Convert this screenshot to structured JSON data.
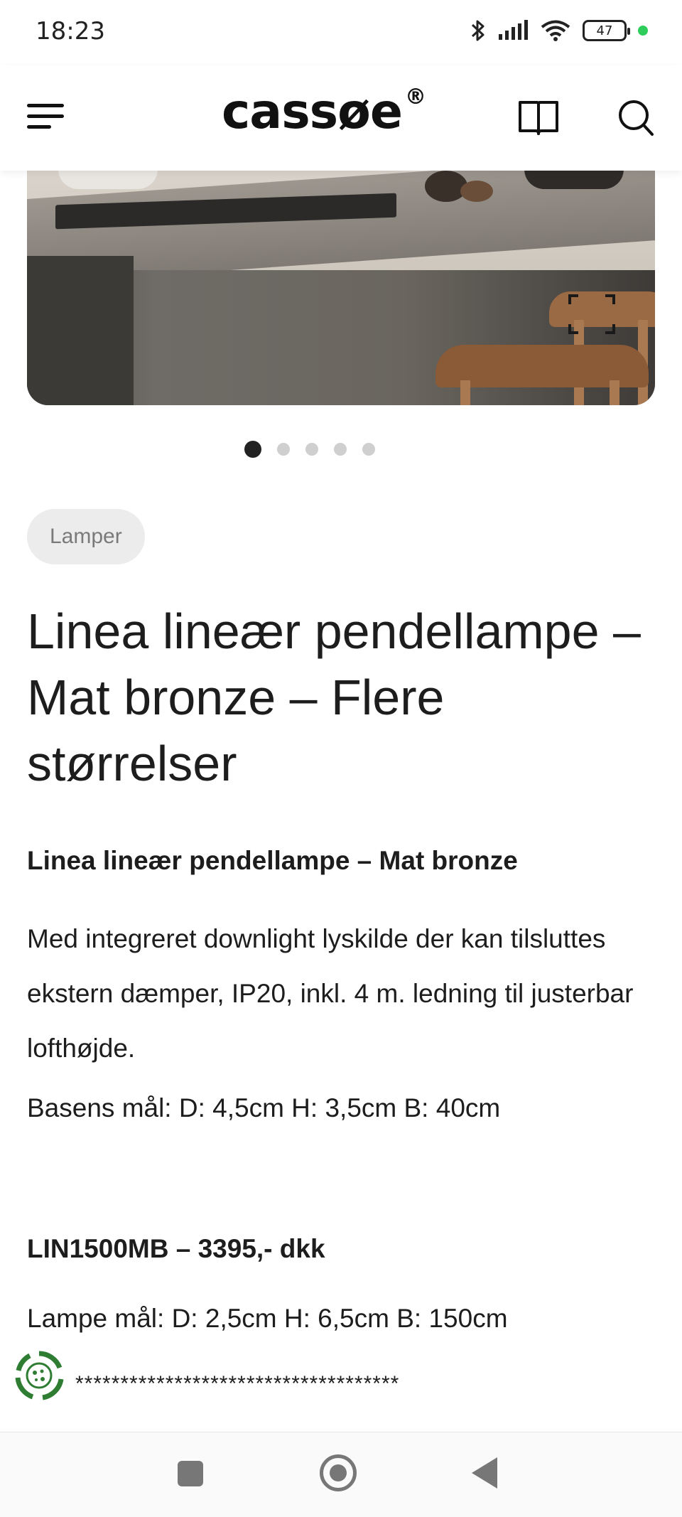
{
  "status_bar": {
    "time": "18:23",
    "battery": "47",
    "icons": [
      "bluetooth-icon",
      "signal-icon",
      "wifi-icon",
      "battery-icon"
    ]
  },
  "header": {
    "logo": "cassøe",
    "logo_mark": "®",
    "icons": [
      "menu-icon",
      "catalog-book-icon",
      "search-icon"
    ]
  },
  "gallery": {
    "slide_count": 5,
    "active_slide": 1
  },
  "product": {
    "category": "Lamper",
    "title": "Linea lineær pendellampe – Mat bronze – Flere størrelser",
    "subheading": "Linea lineær pendellampe – Mat bronze",
    "description": "Med integreret downlight lyskilde der kan tilsluttes ekstern dæmper, IP20, inkl. 4 m. ledning til justerbar lofthøjde.",
    "base_dimensions": "Basens mål: D: 4,5cm H: 3,5cm B: 40cm",
    "variant_heading": "LIN1500MB – 3395,- dkk",
    "lamp_dimensions": "Lampe mål: D: 2,5cm H: 6,5cm B: 150cm",
    "separator": "************************************"
  },
  "colors": {
    "text": "#1d1d1d",
    "pill_bg": "#ececec",
    "status_dot": "#2ecc5a",
    "cookie_green": "#2e7d32"
  }
}
